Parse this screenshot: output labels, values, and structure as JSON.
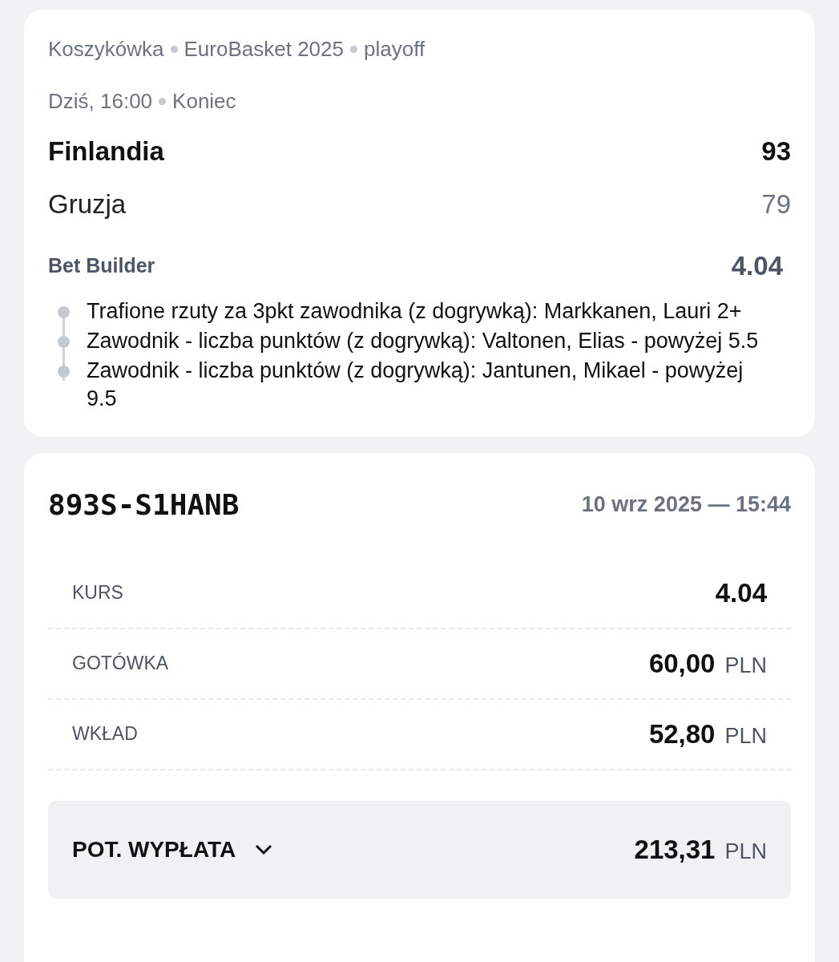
{
  "match": {
    "breadcrumb": [
      "Koszykówka",
      "EuroBasket 2025",
      "playoff"
    ],
    "status": [
      "Dziś, 16:00",
      "Koniec"
    ],
    "teams": [
      {
        "name": "Finlandia",
        "score": "93",
        "winner": true
      },
      {
        "name": "Gruzja",
        "score": "79",
        "winner": false
      }
    ],
    "bet": {
      "label": "Bet Builder",
      "odds": "4.04",
      "legs": [
        "Trafione rzuty za 3pkt zawodnika (z dogrywką): Markkanen, Lauri 2+",
        "Zawodnik - liczba punktów (z dogrywką): Valtonen,  Elias - powyżej 5.5",
        "Zawodnik - liczba punktów (z dogrywką): Jantunen, Mikael - powyżej 9.5"
      ]
    }
  },
  "ticket": {
    "code": "893S-S1HANB",
    "date": "10 wrz 2025 — 15:44",
    "rows": [
      {
        "label": "KURS",
        "value": "4.04"
      },
      {
        "label": "GOTÓWKA",
        "value": "60,00",
        "currency": "PLN"
      },
      {
        "label": "WKŁAD",
        "value": "52,80",
        "currency": "PLN"
      }
    ],
    "payout": {
      "label": "POT. WYPŁATA",
      "value": "213,31",
      "currency": "PLN",
      "expanded": false
    }
  }
}
